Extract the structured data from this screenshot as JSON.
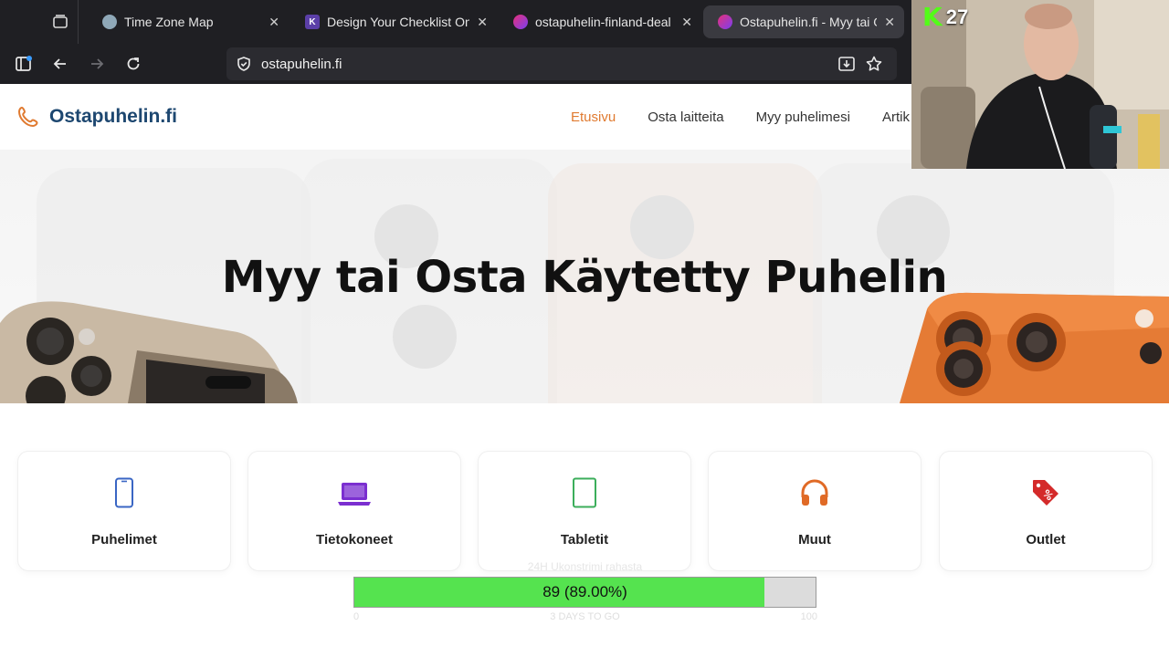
{
  "browser": {
    "tabs": [
      {
        "title": "Time Zone Map",
        "favicon": "globe-favicon",
        "active": false
      },
      {
        "title": "Design Your Checklist Online",
        "favicon": "k-favicon",
        "active": false
      },
      {
        "title": "ostapuhelin-finland-deal - L",
        "favicon": "heart-favicon",
        "active": false
      },
      {
        "title": "Ostapuhelin.fi - Myy tai Osta",
        "favicon": "heart-favicon",
        "active": true
      }
    ],
    "url": "ostapuhelin.fi"
  },
  "site": {
    "logo_text": "Ostapuhelin.fi",
    "brand_color": "#1d4770",
    "accent_color": "#e07a30",
    "nav": [
      "Etusivu",
      "Osta laitteita",
      "Myy puhelimesi",
      "Artik"
    ],
    "hero_title": "Myy tai Osta Käytetty Puhelin",
    "categories": [
      {
        "label": "Puhelimet",
        "icon": "smartphone-icon",
        "color": "#3a66c4"
      },
      {
        "label": "Tietokoneet",
        "icon": "laptop-icon",
        "color": "#7b2fd0"
      },
      {
        "label": "Tabletit",
        "icon": "tablet-icon",
        "color": "#3cae5b"
      },
      {
        "label": "Muut",
        "icon": "headphones-icon",
        "color": "#e06a26"
      },
      {
        "label": "Outlet",
        "icon": "discount-tag-icon",
        "color": "#d42a2a"
      }
    ]
  },
  "progress": {
    "caption": "24H Ukonstrimi rahasta",
    "value": 89,
    "max": 100,
    "label": "89 (89.00%)",
    "min_label": "0",
    "max_label": "100",
    "sub_label": "3 DAYS TO GO",
    "fill_color": "#55e34f"
  },
  "stream": {
    "badge_letter": "K",
    "viewer_count": "27",
    "badge_color": "#53fc18"
  }
}
